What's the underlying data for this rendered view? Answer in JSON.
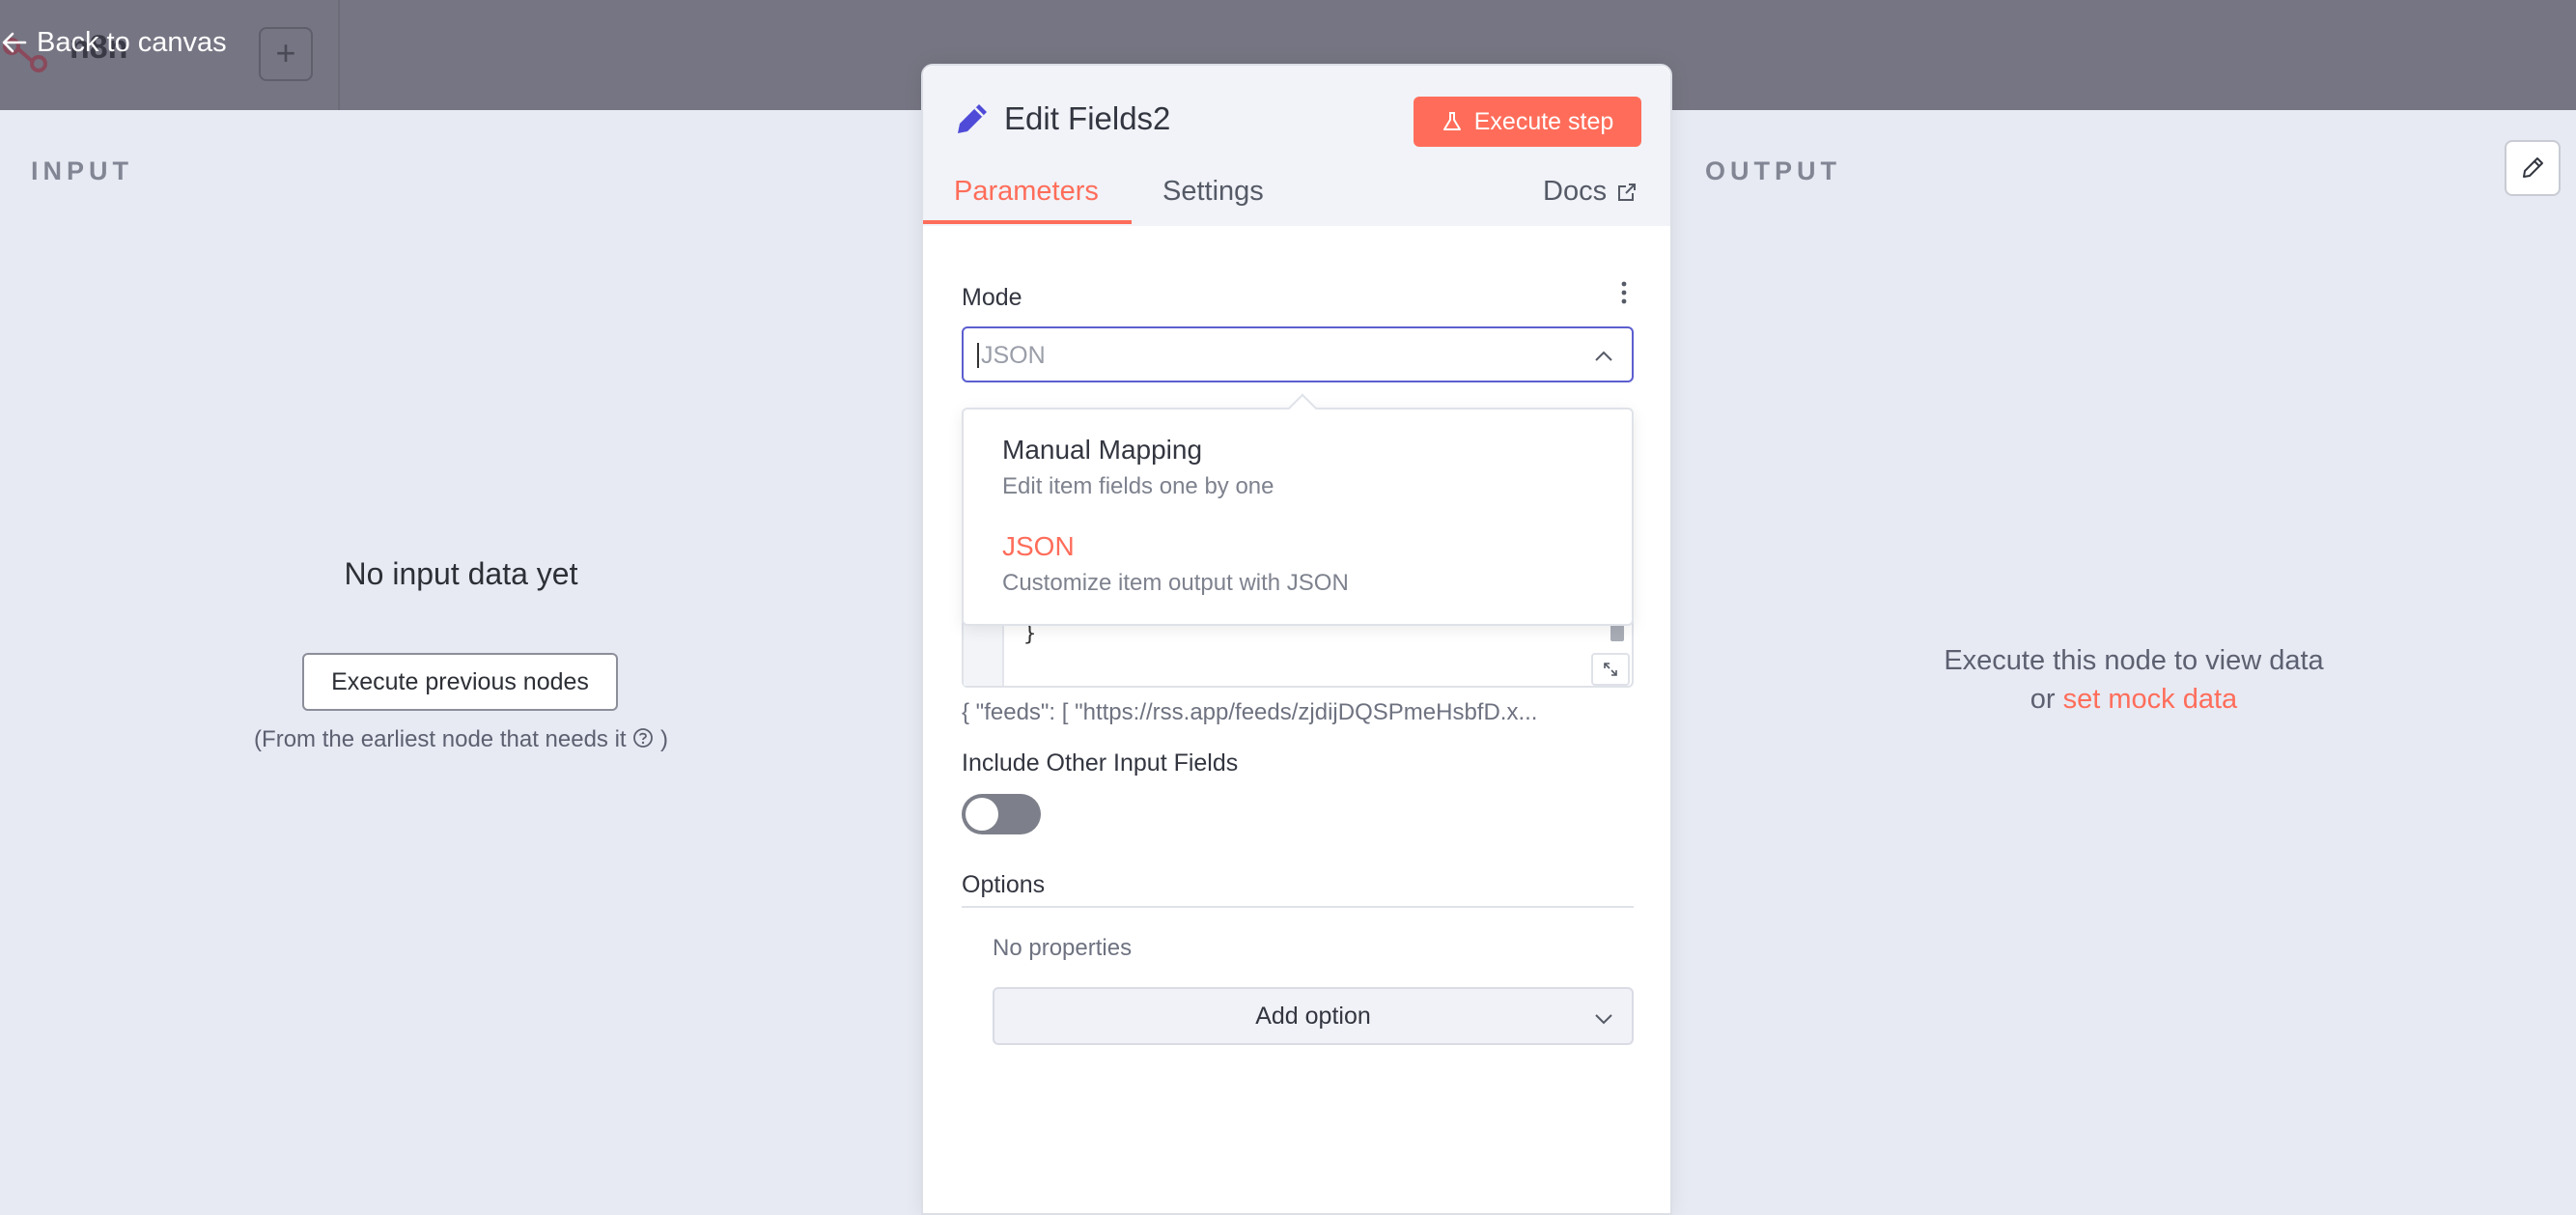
{
  "topbar": {
    "logo_text": "n8n",
    "back_label": "Back to canvas",
    "plus_label": "+"
  },
  "input_panel": {
    "label": "INPUT",
    "empty_title": "No input data yet",
    "execute_previous_label": "Execute previous nodes",
    "note": "(From the earliest node that needs it",
    "note_end": ")"
  },
  "output_panel": {
    "label": "OUTPUT",
    "message": "Execute this node to view data",
    "or_text": "or",
    "mock_link": "set mock data"
  },
  "editor": {
    "title": "Edit Fields2",
    "execute_step_label": "Execute step",
    "tabs": [
      {
        "label": "Parameters",
        "active": true
      },
      {
        "label": "Settings",
        "active": false
      }
    ],
    "docs_label": "Docs",
    "mode": {
      "label": "Mode",
      "selected_value": "JSON",
      "options": [
        {
          "title": "Manual Mapping",
          "description": "Edit item fields one by one",
          "selected": false
        },
        {
          "title": "JSON",
          "description": "Customize item output with JSON",
          "selected": true
        }
      ]
    },
    "json_closing": "}",
    "json_preview": "{   \"feeds\": [     \"https://rss.app/feeds/zjdijDQSPmeHsbfD.x...",
    "include_other_label": "Include Other Input Fields",
    "include_other_enabled": false,
    "options_label": "Options",
    "no_properties": "No properties",
    "add_option_label": "Add option"
  },
  "colors": {
    "accent": "#ff6d5a",
    "focus_border": "#5c5ecf",
    "title_icon": "#4f4bd8",
    "overlay": "#767583"
  }
}
